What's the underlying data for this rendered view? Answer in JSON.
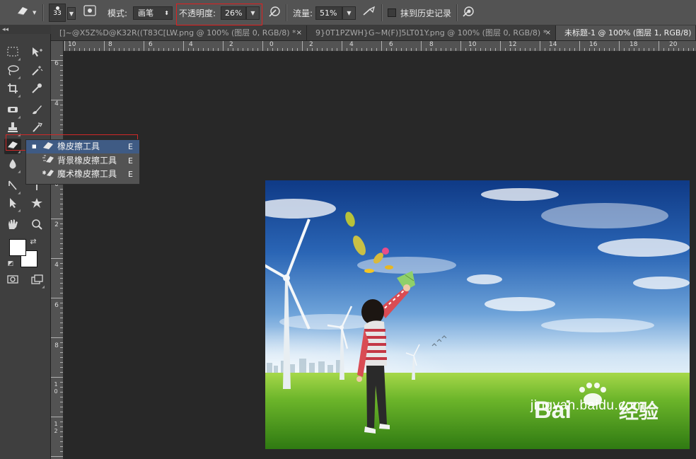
{
  "options_bar": {
    "brush_size": "33",
    "mode_label": "模式:",
    "mode_value": "画笔",
    "opacity_label": "不透明度:",
    "opacity_value": "26%",
    "flow_label": "流量:",
    "flow_value": "51%",
    "history_checkbox_label": "抹到历史记录",
    "history_checked": false
  },
  "toolbox": {
    "collapse_glyph": "◂◂"
  },
  "tabs": [
    {
      "label": "[]~@X5Z%D@K32R((T83C[LW.png @ 100% (图层 0, RGB/8) *",
      "close": "×",
      "active": false
    },
    {
      "label": "9}0T1PZWH}G~M(F)]5LT01Y.png @ 100% (图层 0, RGB/8) *",
      "close": "×",
      "active": false
    },
    {
      "label": "未标题-1 @ 100% (图层 1, RGB/8)",
      "close": "×",
      "active": true
    }
  ],
  "flyout": {
    "items": [
      {
        "label": "橡皮擦工具",
        "shortcut": "E",
        "selected": true
      },
      {
        "label": "背景橡皮擦工具",
        "shortcut": "E",
        "selected": false
      },
      {
        "label": "魔术橡皮擦工具",
        "shortcut": "E",
        "selected": false
      }
    ],
    "selected_marker": "■"
  },
  "rulers": {
    "top_labels": [
      "10",
      "8",
      "6",
      "4",
      "2",
      "0",
      "2",
      "4",
      "6",
      "8",
      "10",
      "12",
      "14",
      "16",
      "18",
      "20"
    ],
    "left_labels": [
      "6",
      "4",
      "2",
      "0",
      "2",
      "4",
      "6",
      "8",
      "1 0",
      "1 2"
    ]
  },
  "watermark": {
    "text": "jingyan.baidu.com",
    "logo_text": "Baidu经验"
  },
  "colors": {
    "ui_dark": "#282828",
    "panel": "#535353",
    "highlight_red": "#e02020",
    "selection_blue": "#3f5b84"
  }
}
